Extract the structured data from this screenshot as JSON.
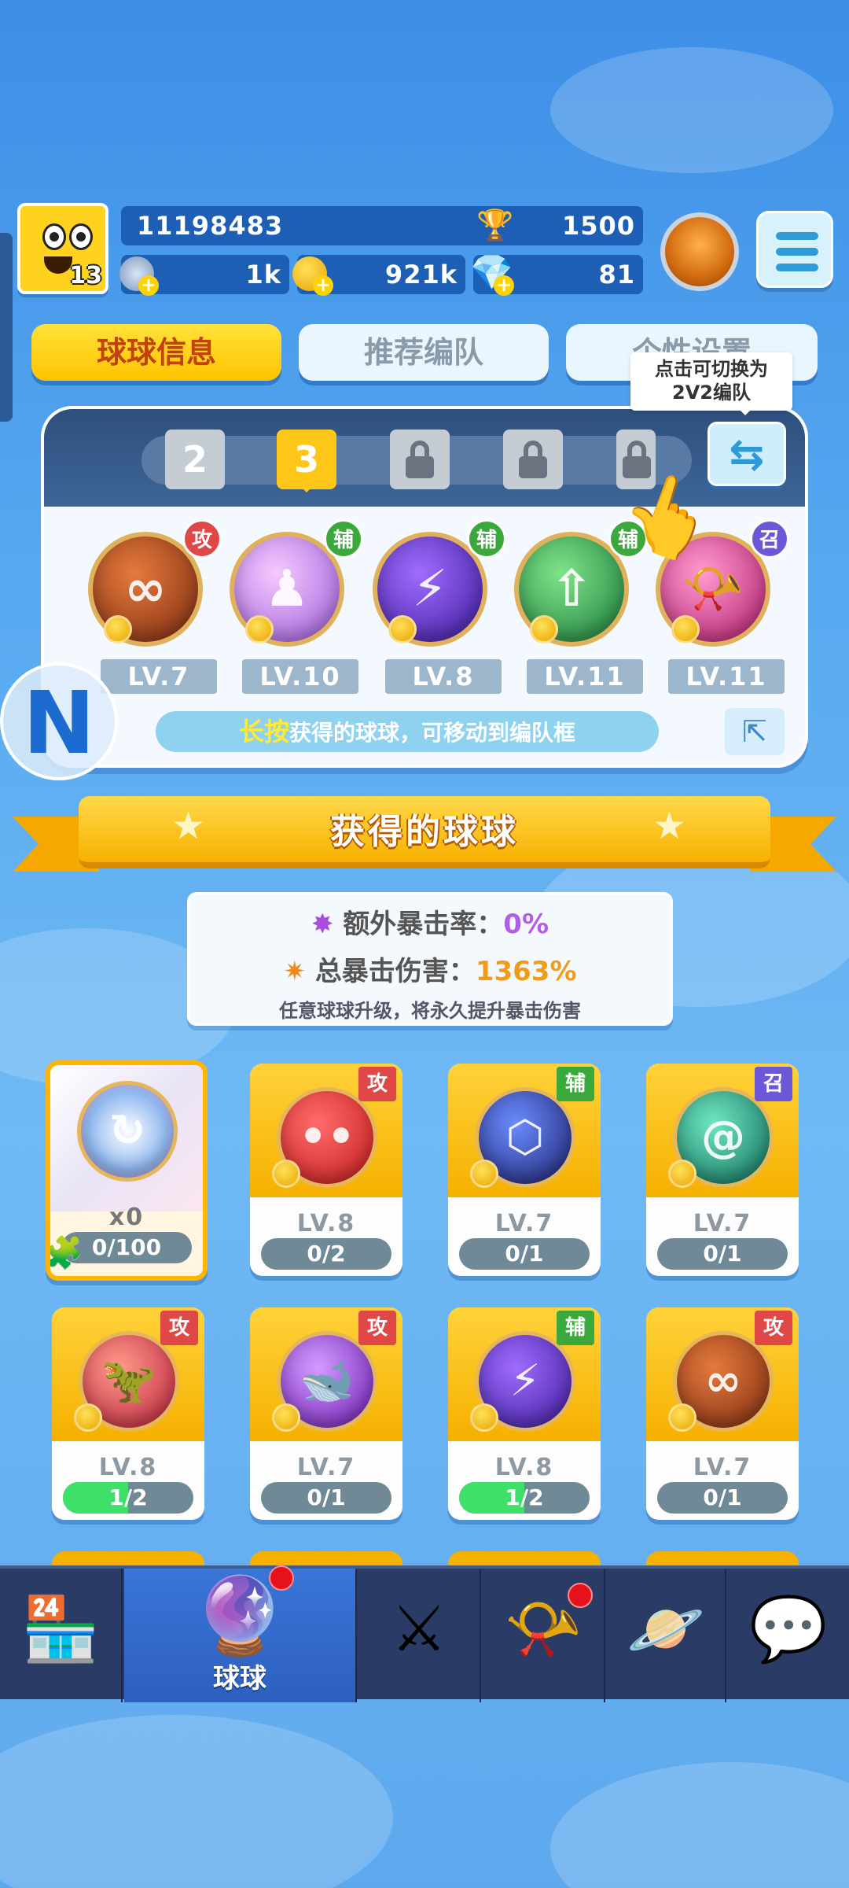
{
  "player": {
    "level": "13",
    "id": "11198483",
    "trophies": "1500",
    "stars": "1k",
    "coins": "921k",
    "gems": "81"
  },
  "tabs": [
    "球球信息",
    "推荐编队",
    "个性设置"
  ],
  "team": {
    "slots": [
      "2",
      "3"
    ],
    "tooltip_line1": "点击可切换为",
    "tooltip_line2": "2V2编队",
    "balls": [
      {
        "role": "攻",
        "level": "LV.7"
      },
      {
        "role": "辅",
        "level": "LV.10"
      },
      {
        "role": "辅",
        "level": "LV.8"
      },
      {
        "role": "辅",
        "level": "LV.11"
      },
      {
        "role": "召",
        "level": "LV.11"
      }
    ],
    "hint_key": "长按",
    "hint_text": "获得的球球，可移动到编队框"
  },
  "collection": {
    "title": "获得的球球",
    "crit_rate_label": "额外暴击率：",
    "crit_rate_value": "0%",
    "crit_damage_label": "总暴击伤害：",
    "crit_damage_value": "1363%",
    "note": "任意球球升级，将永久提升暴击伤害"
  },
  "cards": [
    {
      "role": "",
      "level": "x0",
      "progress": "0/100",
      "fill": 0
    },
    {
      "role": "攻",
      "level": "LV.8",
      "progress": "0/2",
      "fill": 0
    },
    {
      "role": "辅",
      "level": "LV.7",
      "progress": "0/1",
      "fill": 0
    },
    {
      "role": "召",
      "level": "LV.7",
      "progress": "0/1",
      "fill": 0
    },
    {
      "role": "攻",
      "level": "LV.8",
      "progress": "1/2",
      "fill": 0.5
    },
    {
      "role": "攻",
      "level": "LV.7",
      "progress": "0/1",
      "fill": 0
    },
    {
      "role": "辅",
      "level": "LV.8",
      "progress": "1/2",
      "fill": 0.5
    },
    {
      "role": "攻",
      "level": "LV.7",
      "progress": "0/1",
      "fill": 0
    }
  ],
  "nav": {
    "active_label": "球球"
  }
}
